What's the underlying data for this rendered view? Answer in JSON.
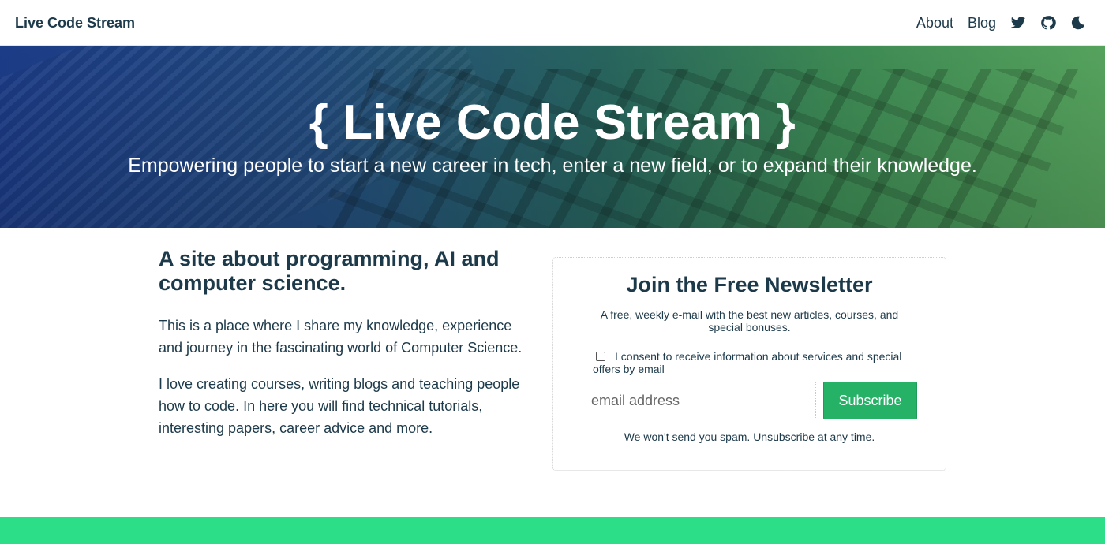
{
  "header": {
    "brand": "Live Code Stream",
    "nav": {
      "about": "About",
      "blog": "Blog"
    },
    "icons": [
      "twitter-icon",
      "github-icon",
      "moon-icon"
    ]
  },
  "hero": {
    "title": "{ Live Code Stream }",
    "subtitle": "Empowering people to start a new career in tech, enter a new field, or to expand their knowledge."
  },
  "intro": {
    "heading": "A site about programming, AI and computer science.",
    "paragraph1": "This is a place where I share my knowledge, experience and journey in the fascinating world of Computer Science.",
    "paragraph2": "I love creating courses, writing blogs and teaching people how to code. In here you will find technical tutorials, interesting papers, career advice and more."
  },
  "newsletter": {
    "title": "Join the Free Newsletter",
    "description": "A free, weekly e-mail with the best new articles, courses, and special bonuses.",
    "consent_label": "I consent to receive information about services and special offers by email",
    "email_placeholder": "email address",
    "subscribe_label": "Subscribe",
    "note": "We won't send you spam. Unsubscribe at any time."
  },
  "colors": {
    "text": "#1d3a4a",
    "accent_green": "#25b266",
    "footer_band": "#2bde87"
  }
}
